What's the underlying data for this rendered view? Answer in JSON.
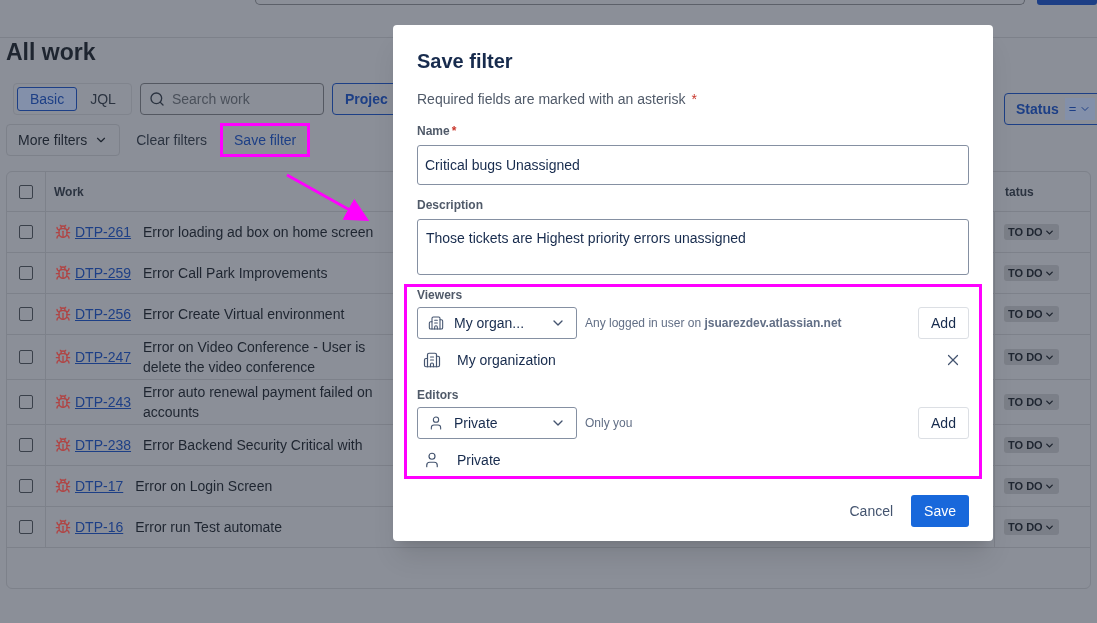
{
  "page": {
    "title": "All work"
  },
  "filters": {
    "modes": [
      {
        "label": "Basic",
        "selected": true
      },
      {
        "label": "JQL",
        "selected": false
      }
    ],
    "search": {
      "placeholder": "Search work"
    },
    "project_button": "Projec",
    "status_filter": {
      "label": "Status",
      "operator": "="
    },
    "more_filters": "More filters",
    "clear_filters": "Clear filters",
    "save_filter": "Save filter"
  },
  "table": {
    "all_checked": false,
    "columns": [
      "Work",
      "tatus"
    ],
    "rows": [
      {
        "key": "DTP-261",
        "title": "Error loading ad box on home screen",
        "status": "TO DO",
        "checked": false
      },
      {
        "key": "DTP-259",
        "title": "Error Call Park Improvements",
        "status": "TO DO",
        "checked": false
      },
      {
        "key": "DTP-256",
        "title": "Error Create Virtual environment",
        "status": "TO DO",
        "checked": false
      },
      {
        "key": "DTP-247",
        "title": "Error on Video Conference - User is\ndelete the video conference",
        "status": "TO DO",
        "checked": false
      },
      {
        "key": "DTP-243",
        "title": "Error auto renewal payment failed on\naccounts",
        "status": "TO DO",
        "checked": false
      },
      {
        "key": "DTP-238",
        "title": "Error Backend Security Critical with",
        "status": "TO DO",
        "checked": false
      },
      {
        "key": "DTP-17",
        "title": "Error on Login Screen",
        "status": "TO DO",
        "checked": false
      },
      {
        "key": "DTP-16",
        "title": "Error run Test automate",
        "status": "TO DO",
        "checked": false
      }
    ]
  },
  "dialog": {
    "title": "Save filter",
    "required_note": "Required fields are marked with an asterisk",
    "required_mark": "*",
    "name": {
      "label": "Name",
      "required_mark": "*",
      "value": "Critical bugs Unassigned"
    },
    "description": {
      "label": "Description",
      "value": "Those tickets are Highest priority errors unassigned"
    },
    "permissions": [
      {
        "kind": "building",
        "label": "Viewers",
        "select": "My organ...",
        "hint": "Any logged in user on **jsuarezdev.atlassian.net**",
        "add": "Add",
        "entry": "My organization",
        "removable": true
      },
      {
        "kind": "person",
        "label": "Editors",
        "select": "Private",
        "hint": "Only you",
        "add": "Add",
        "entry": "Private",
        "removable": false
      }
    ],
    "cancel": "Cancel",
    "save": "Save"
  }
}
